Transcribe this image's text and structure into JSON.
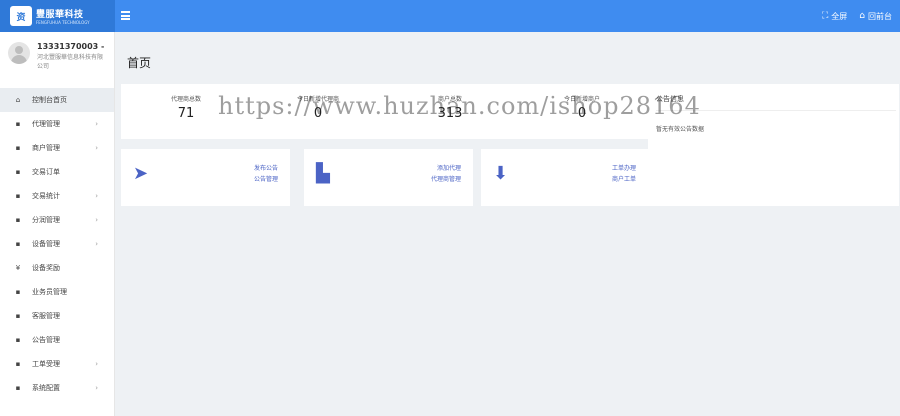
{
  "header": {
    "logo_mark": "资",
    "brand_name": "豐服華科技",
    "brand_sub": "FENGFUHUA TECHNOLOGY",
    "fullscreen_label": "全屏",
    "home_label": "回前台"
  },
  "user": {
    "name": "13331370003 -",
    "company": "河北豐服華信息科技有限公司"
  },
  "sidebar": {
    "items": [
      {
        "icon": "home-icon",
        "glyph": "⌂",
        "label": "控制台首页",
        "arrow": ""
      },
      {
        "icon": "agent-icon",
        "glyph": "▪",
        "label": "代理管理",
        "arrow": "›"
      },
      {
        "icon": "merchant-icon",
        "glyph": "▪",
        "label": "商户管理",
        "arrow": "›"
      },
      {
        "icon": "order-icon",
        "glyph": "▪",
        "label": "交易订单",
        "arrow": ""
      },
      {
        "icon": "stats-icon",
        "glyph": "▪",
        "label": "交易统计",
        "arrow": "›"
      },
      {
        "icon": "split-icon",
        "glyph": "▪",
        "label": "分润管理",
        "arrow": "›"
      },
      {
        "icon": "device-icon",
        "glyph": "▪",
        "label": "设备管理",
        "arrow": "›"
      },
      {
        "icon": "yuan-icon",
        "glyph": "¥",
        "label": "设备奖励",
        "arrow": ""
      },
      {
        "icon": "salesman-icon",
        "glyph": "▪",
        "label": "业务员管理",
        "arrow": ""
      },
      {
        "icon": "customer-icon",
        "glyph": "▪",
        "label": "客服管理",
        "arrow": ""
      },
      {
        "icon": "notice-icon",
        "glyph": "▪",
        "label": "公告管理",
        "arrow": ""
      },
      {
        "icon": "ticket-icon",
        "glyph": "▪",
        "label": "工单受理",
        "arrow": "›"
      },
      {
        "icon": "settings-icon",
        "glyph": "▪",
        "label": "系统配置",
        "arrow": "›"
      }
    ]
  },
  "main": {
    "page_title": "首页",
    "stats": [
      {
        "label": "代理商总数",
        "value": "71"
      },
      {
        "label": "今日新增代理商",
        "value": "0"
      },
      {
        "label": "商户总数",
        "value": "313"
      },
      {
        "label": "今日新增商户",
        "value": "0"
      }
    ],
    "features": [
      {
        "icon": "send-icon",
        "glyph": "➤",
        "line1": "发布公告",
        "line2": "公告管理"
      },
      {
        "icon": "file-add-icon",
        "glyph": "▙",
        "line1": "添加代理",
        "line2": "代理商管理"
      },
      {
        "icon": "download-icon",
        "glyph": "⬇",
        "line1": "工单办理",
        "line2": "商户工单"
      }
    ],
    "notice": {
      "title": "公告信息",
      "empty_text": "暂无有效公告数据"
    }
  },
  "watermark": "https://www.huzhan.com/ishop28164"
}
